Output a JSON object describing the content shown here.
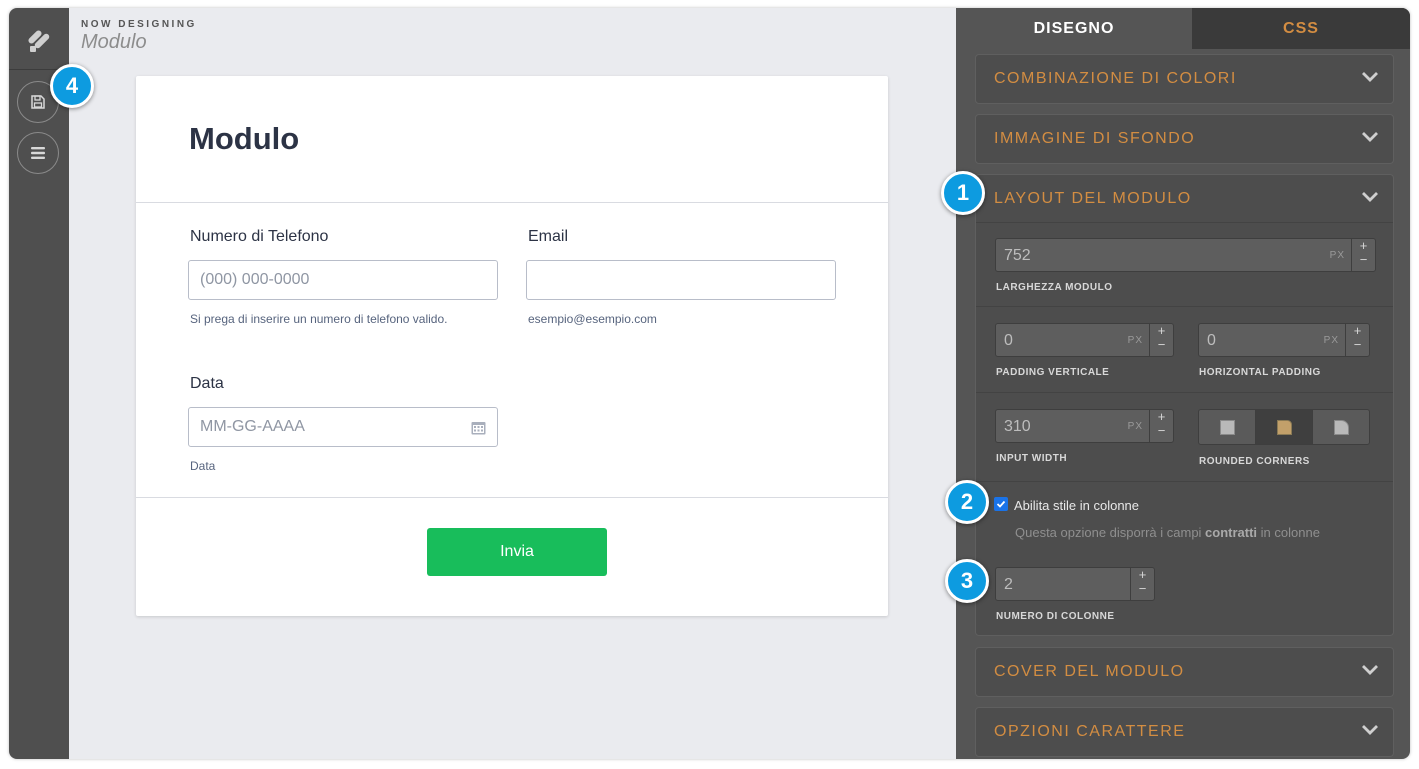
{
  "header": {
    "now_designing": "NOW DESIGNING",
    "form_name": "Modulo"
  },
  "rail": {
    "logo_icon": "jotform-logo-icon",
    "save_icon": "save-icon",
    "menu_icon": "menu-icon"
  },
  "badges": {
    "b1": "1",
    "b2": "2",
    "b3": "3",
    "b4": "4"
  },
  "form": {
    "title": "Modulo",
    "phone": {
      "label": "Numero di Telefono",
      "placeholder": "(000) 000-0000",
      "sublabel": "Si prega di inserire un numero di telefono valido."
    },
    "email": {
      "label": "Email",
      "value": "",
      "sublabel": "esempio@esempio.com"
    },
    "date": {
      "label": "Data",
      "placeholder": "MM-GG-AAAA",
      "sublabel": "Data"
    },
    "submit": "Invia"
  },
  "panel": {
    "tabs": [
      {
        "label": "DISEGNO",
        "active": true
      },
      {
        "label": "CSS",
        "active": false
      }
    ],
    "sections": {
      "color_scheme": "COMBINAZIONE DI COLORI",
      "background_image": "IMMAGINE DI SFONDO",
      "form_layout": "LAYOUT DEL MODULO",
      "form_cover": "COVER DEL MODULO",
      "font_options": "OPZIONI CARATTERE"
    },
    "layout": {
      "form_width": {
        "value": "752",
        "unit": "PX",
        "label": "LARGHEZZA MODULO"
      },
      "padding_vertical": {
        "value": "0",
        "unit": "PX",
        "label": "PADDING VERTICALE"
      },
      "padding_horizontal": {
        "value": "0",
        "unit": "PX",
        "label": "HORIZONTAL PADDING"
      },
      "input_width": {
        "value": "310",
        "unit": "PX",
        "label": "INPUT WIDTH"
      },
      "rounded_corners": {
        "label": "ROUNDED CORNERS",
        "selected": "medium"
      },
      "columns_toggle": {
        "label": "Abilita stile in colonne",
        "checked": true,
        "hint_prefix": "Questa opzione disporrà i campi ",
        "hint_bold": "contratti",
        "hint_suffix": " in colonne"
      },
      "columns_count": {
        "value": "2",
        "label": "NUMERO DI COLONNE"
      }
    }
  },
  "colors": {
    "accent": "#d38d42",
    "submit": "#18bd5b",
    "badge": "#0d9be0"
  }
}
